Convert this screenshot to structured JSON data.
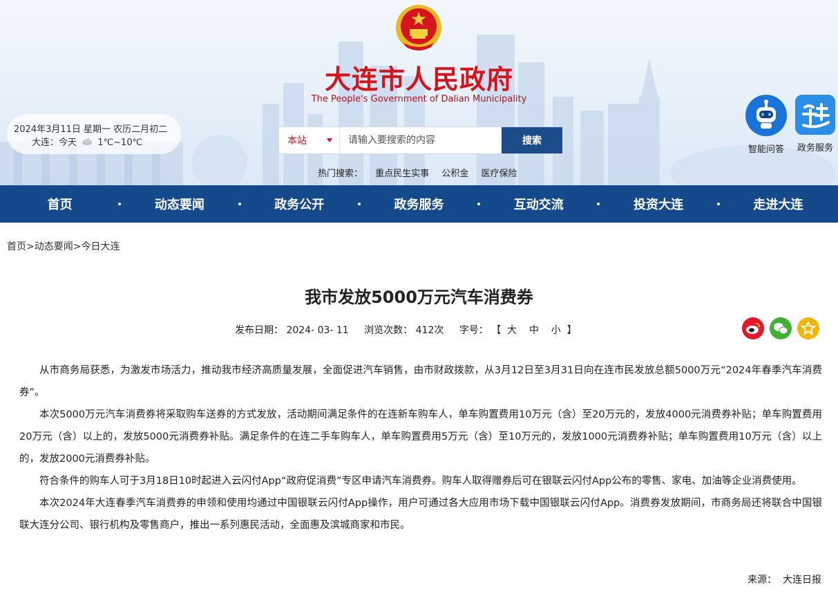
{
  "header": {
    "title": "大连市人民政府",
    "subtitle": "The People's Government of Dalian Municipality",
    "date": "2024年3月11日  星期一  农历二月初二",
    "weather_city": "大连：今天",
    "weather_temp": "1℃~10℃",
    "search": {
      "scope": "本站",
      "placeholder": "请输入要搜索的内容",
      "button": "搜索"
    },
    "hot_label": "热门搜索：",
    "hot_items": [
      "重点民生实事",
      "公积金",
      "医疗保险"
    ],
    "quick_links": [
      {
        "label": "智能问答",
        "icon": "robot-icon"
      },
      {
        "label": "政务服务",
        "icon": "lian-logo-icon"
      }
    ]
  },
  "nav": [
    "首页",
    "动态要闻",
    "政务公开",
    "政务服务",
    "互动交流",
    "投资大连",
    "走进大连"
  ],
  "breadcrumb": "首页>动态要闻>今日大连",
  "article": {
    "title": "我市发放5000万元汽车消费券",
    "publish_label": "发布日期：",
    "publish_date": "2024- 03- 11",
    "views_label": "浏览次数：",
    "views": "412次",
    "fontsize_label": "字号：",
    "fontsize_options": "【  大    中    小  】",
    "paragraphs": [
      "从市商务局获悉，为激发市场活力，推动我市经济高质量发展，全面促进汽车销售，由市财政拨款，从3月12日至3月31日向在连市民发放总额5000万元“2024年春季汽车消费券”。",
      "本次5000万元汽车消费券将采取购车送券的方式发放，活动期间满足条件的在连新车购车人，单车购置费用10万元（含）至20万元的，发放4000元消费券补贴；单车购置费用20万元（含）以上的，发放5000元消费券补贴。满足条件的在连二手车购车人，单车购置费用5万元（含）至10万元的，发放1000元消费券补贴；单车购置费用10万元（含）以上的，发放2000元消费券补贴。",
      "符合条件的购车人可于3月18日10时起进入云闪付App“政府促消费”专区申请汽车消费券。购车人取得赠券后可在银联云闪付App公布的零售、家电、加油等企业消费使用。",
      "本次2024年大连春季汽车消费券的申领和使用均通过中国银联云闪付App操作，用户可通过各大应用市场下载中国银联云闪付App。消费券发放期间，市商务局还将联合中国银联大连分公司、银行机构及零售商户，推出一系列惠民活动，全面惠及滨城商家和市民。"
    ],
    "source": "来源：  大连日报"
  },
  "share_icons": [
    "weibo-icon",
    "wechat-icon",
    "favorite-star-icon"
  ],
  "colors": {
    "brand_red": "#d5141b",
    "nav_blue": "#14498b",
    "search_blue": "#1d4c8a"
  }
}
